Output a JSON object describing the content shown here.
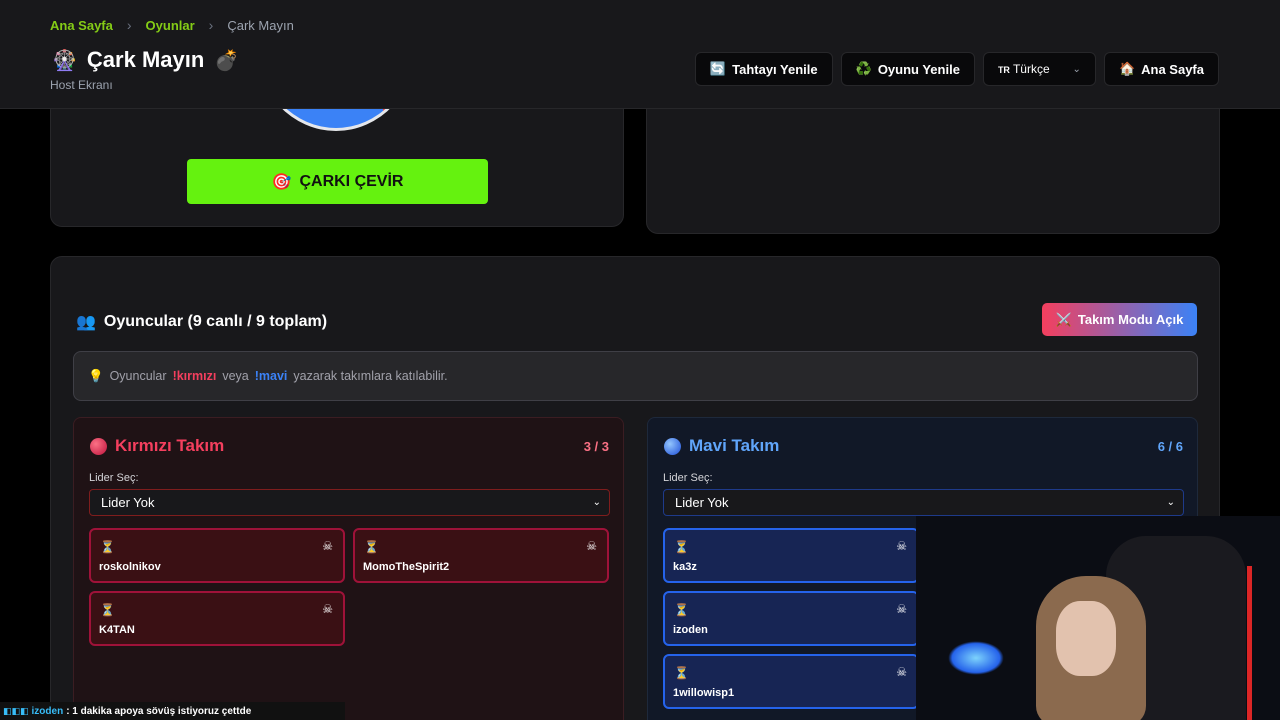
{
  "breadcrumb": {
    "home": "Ana Sayfa",
    "games": "Oyunlar",
    "current": "Çark Mayın"
  },
  "header": {
    "title_icon": "🎡",
    "title": "Çark Mayın",
    "title_suffix_icon": "💣",
    "subtitle": "Host Ekranı",
    "buttons": [
      {
        "icon": "🔄",
        "label": "Tahtayı Yenile"
      },
      {
        "icon": "♻️",
        "label": "Oyunu Yenile"
      },
      {
        "icon": "🏠",
        "label": "Ana Sayfa"
      }
    ],
    "language": {
      "flag": "TR",
      "label": "Türkçe"
    }
  },
  "wheel": {
    "spin_icon": "🎯",
    "spin_label": "ÇARKI ÇEVİR"
  },
  "players": {
    "icon": "👥",
    "title": "Oyuncular (9 canlı / 9 toplam)",
    "team_mode_icon": "⚔️",
    "team_mode_label": "Takım Modu Açık",
    "hint": {
      "icon": "💡",
      "prefix": "Oyuncular",
      "red_cmd": "!kırmızı",
      "mid": "veya",
      "blue_cmd": "!mavi",
      "suffix": "yazarak takımlara katılabilir."
    }
  },
  "teams": {
    "red": {
      "name": "Kırmızı Takım",
      "count": "3 / 3",
      "leader_label": "Lider Seç:",
      "leader_value": "Lider Yok",
      "members": [
        "roskolnikov",
        "MomoTheSpirit2",
        "K4TAN"
      ]
    },
    "blue": {
      "name": "Mavi Takım",
      "count": "6 / 6",
      "leader_label": "Lider Seç:",
      "leader_value": "Lider Yok",
      "members": [
        "ka3z",
        "izoden",
        "1willowisp1"
      ]
    }
  },
  "icons": {
    "pending": "⏳",
    "kick": "☠",
    "chevron": "⌄"
  },
  "chat": {
    "user": "izoden",
    "message": ": 1 dakika apoya sövüş istiyoruz çettde"
  },
  "colors": {
    "accent_green": "#65f20f",
    "red": "#f43f5e",
    "blue": "#3b82f6"
  }
}
